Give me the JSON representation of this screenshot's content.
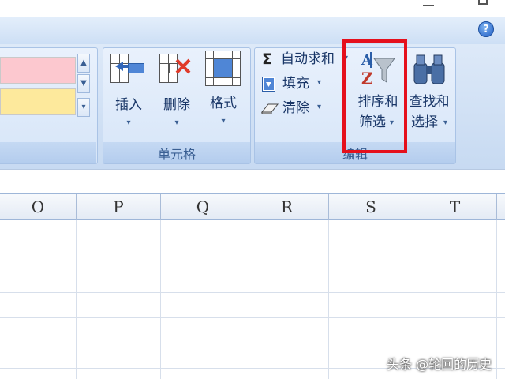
{
  "ribbon": {
    "help_icon_text": "?",
    "cells_group": {
      "label": "单元格",
      "insert_label": "插入",
      "delete_label": "删除",
      "format_label": "格式"
    },
    "editing_group": {
      "label": "编辑",
      "autosum_label": "自动求和",
      "fill_label": "填充",
      "clear_label": "清除",
      "sort_filter_label_line1": "排序和",
      "sort_filter_label_line2": "筛选",
      "find_select_label_line1": "查找和",
      "find_select_label_line2": "选择"
    },
    "styles_gallery": {
      "swatch_colors": [
        "#fcc8cf",
        "#fde99c"
      ]
    }
  },
  "sheet": {
    "columns": [
      "O",
      "P",
      "Q",
      "R",
      "S",
      "T"
    ]
  },
  "watermark": "头条 @轮回的历史",
  "colors": {
    "highlight": "#e5101c",
    "ribbon_text": "#1a3768",
    "group_label": "#3a5f93"
  },
  "icons": [
    "insert-cells-icon",
    "delete-cells-icon",
    "format-cells-icon",
    "sigma-icon",
    "fill-down-icon",
    "eraser-icon",
    "sort-filter-icon",
    "binoculars-icon",
    "help-icon",
    "minimize-icon",
    "restore-icon"
  ]
}
